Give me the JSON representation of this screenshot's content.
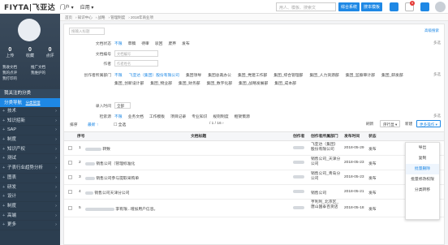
{
  "topbar": {
    "logo": "FIYTA|飞亚达",
    "nav": [
      "门户 ▾",
      "应用 ▾"
    ],
    "search_placeholder": "用人、模板、搜索文",
    "btn_new_doc": "综合系统",
    "btn_search": "搜本模板",
    "notif_count": "9"
  },
  "sidebar": {
    "stats": [
      {
        "num": "0",
        "label": "上传"
      },
      {
        "num": "0",
        "label": "收藏"
      },
      {
        "num": "0",
        "label": "点评"
      }
    ],
    "quick_links": [
      "我收文档",
      "推广文档",
      "我的点评",
      "我维护的",
      "我打印的"
    ],
    "my_categories": "我关注的分类",
    "category_nav": "分类导航",
    "category_nav_link": "分类管理",
    "items": [
      "技术",
      "知识招新",
      "SAP",
      "制度",
      "知识产权",
      "测试",
      "子表行业趋势分析",
      "图表",
      "研发",
      "设计",
      "制度",
      "高端"
    ],
    "more": "更多"
  },
  "breadcrumb": [
    "首页",
    "知识中心",
    "战略",
    "管理制度",
    "2018年商业项"
  ],
  "filters": {
    "search_placeholder": "搜输入标题",
    "advanced": "高级搜索",
    "status_label": "文档状态",
    "status_options": [
      "不限",
      "草稿",
      "待审",
      "驳回",
      "废弃",
      "发布"
    ],
    "status_more": "多选",
    "docno_label": "文档编号",
    "docno_placeholder": "文档编号",
    "author_label": "作者",
    "author_placeholder": "作者姓名",
    "org_label": "创作者所属部门",
    "orgs": [
      "不限",
      "飞亚达（集团）股份有限公司",
      "集团领导",
      "集团总裁办公",
      "集团_党建工作部",
      "集团_综合管理部",
      "集团_人力资源部",
      "集团_监察审计部",
      "集团_研发部",
      "集团_创新设计部",
      "集团_物业部",
      "集团_财务部",
      "集团_数字化部",
      "集团_战略发展部",
      "集团_成本部"
    ],
    "org_more": "多选",
    "time_label": "录入时间",
    "time_value": "全部",
    "source_label": "检索源",
    "source_options": [
      "不限",
      "业务文档",
      "工作模板",
      "项目记录",
      "专业知识",
      "规则制度",
      "框架策源"
    ],
    "source_more": "多选"
  },
  "toolbar": {
    "sort_label": "排序",
    "sort_value": "最新 ↑",
    "select_all": "全选",
    "pager": "/ 1 / 16 ›",
    "btn_refresh": "刷新",
    "btn_nav": "序行显 ▾",
    "btn_new": "新建",
    "btn_more": "更多操作 ▾"
  },
  "table": {
    "headers": [
      "序号",
      "文档标题",
      "创作者",
      "创作者所属部门",
      "发布时间",
      "状态"
    ],
    "rows": [
      {
        "no": "1",
        "title": "转致",
        "dept": "飞亚达（集团）股份有限公司",
        "date": "2018-05-29",
        "status": "发布"
      },
      {
        "no": "2",
        "title": "销售公司（管理标准化",
        "dept": "销售公司_天津分公司",
        "date": "2018-05-23",
        "status": "发布"
      },
      {
        "no": "3",
        "title": "销售公司参与提取采购单",
        "dept": "销售公司_青岛分公司",
        "date": "2018-05-23",
        "status": "发布"
      },
      {
        "no": "4",
        "title": "销售公司天津分公司",
        "dept": "销售公司",
        "date": "2018-05-21",
        "status": "发布"
      },
      {
        "no": "5",
        "title": "李有限...增加用户信息。",
        "dept": "亨利利_北京区_唐山国泰百货店",
        "date": "2018-05-18",
        "status": "发布"
      }
    ]
  },
  "dropdown": [
    "导出",
    "复制",
    "批量删除",
    "批量修改权限",
    "分类转移"
  ]
}
